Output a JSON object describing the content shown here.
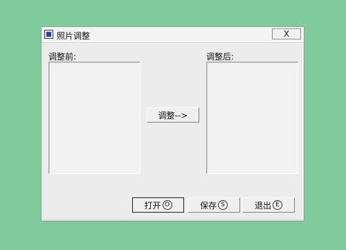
{
  "window": {
    "title": "照片调整",
    "close_label": "X"
  },
  "labels": {
    "before": "调整前:",
    "after": "调整后:"
  },
  "buttons": {
    "adjust": "调整-->",
    "open": "打开",
    "open_accel": "O",
    "save": "保存",
    "save_accel": "S",
    "exit": "退出",
    "exit_accel": "E"
  }
}
